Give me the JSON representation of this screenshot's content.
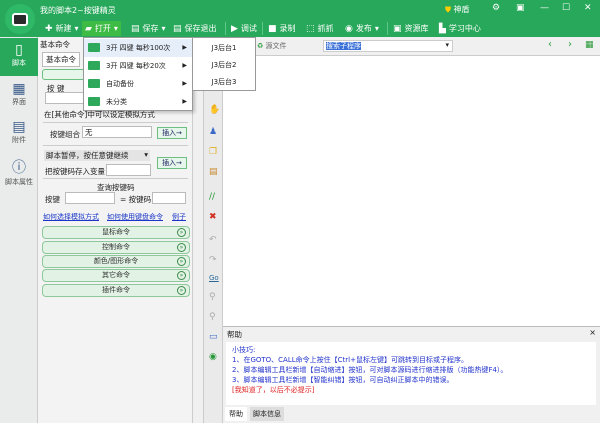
{
  "window": {
    "title": "我的脚本2~按键精灵",
    "user": "神盾"
  },
  "toolbar": [
    {
      "label": "新建",
      "icon": "plus-icon"
    },
    {
      "label": "打开",
      "icon": "folder-icon"
    },
    {
      "label": "保存",
      "icon": "save-icon"
    },
    {
      "label": "保存退出",
      "icon": "save-exit-icon"
    },
    {
      "label": "调试",
      "icon": "play-icon"
    },
    {
      "label": "录制",
      "icon": "record-icon"
    },
    {
      "label": "抓抓",
      "icon": "capture-icon"
    },
    {
      "label": "发布",
      "icon": "publish-icon"
    },
    {
      "label": "资源库",
      "icon": "resource-icon"
    },
    {
      "label": "学习中心",
      "icon": "learn-icon"
    }
  ],
  "sidebar": [
    {
      "label": "脚本"
    },
    {
      "label": "界面"
    },
    {
      "label": "附件"
    },
    {
      "label": "脚本属性"
    }
  ],
  "panel": {
    "header": "基本命令",
    "tab": "基本命令",
    "key_label": "按 键",
    "note": "在[其他命令]中可以设定模拟方式",
    "combo_label": "按键组合",
    "combo_value": "无",
    "insert": "插入→",
    "pause_select": "脚本暂停，按任意键继续",
    "store_label": "把按键码存入变量",
    "query_title": "查询按键码",
    "key2": "按键",
    "keycode": "= 按键码",
    "links": [
      "如何选择模拟方式",
      "如何使用键盘命令",
      "例子"
    ],
    "categories": [
      "鼠标命令",
      "控制命令",
      "颜色/图形命令",
      "其它命令",
      "插件命令"
    ]
  },
  "menu": {
    "items": [
      "3开 四键 每秒100次",
      "3开 四键 每秒20次",
      "自动备份",
      "未分类"
    ],
    "submenu": [
      "J3后台1",
      "J3后台2",
      "J3后台3"
    ]
  },
  "editor": {
    "source_file": "源文件",
    "search_placeholder": "搜索子程序"
  },
  "help": {
    "title": "帮助",
    "lines": [
      "小技巧:",
      "1、在GOTO、CALL命令上按住【Ctrl+鼠标左键】可跳转到目标或子程序。",
      "2、脚本编辑工具栏新增【自动缩进】按钮，可对脚本源码进行缩进排版（功能热键F4）。",
      "3、脚本编辑工具栏新增【智能纠错】按钮，可自动纠正脚本中的错误。"
    ],
    "dismiss": "[我知道了，以后不必提示]",
    "tabs": [
      "帮助",
      "脚本信息"
    ]
  },
  "colors": {
    "brand": "#27a85a",
    "link": "#1a35c8",
    "tip": "#2233cc",
    "dismiss": "#e02020"
  }
}
